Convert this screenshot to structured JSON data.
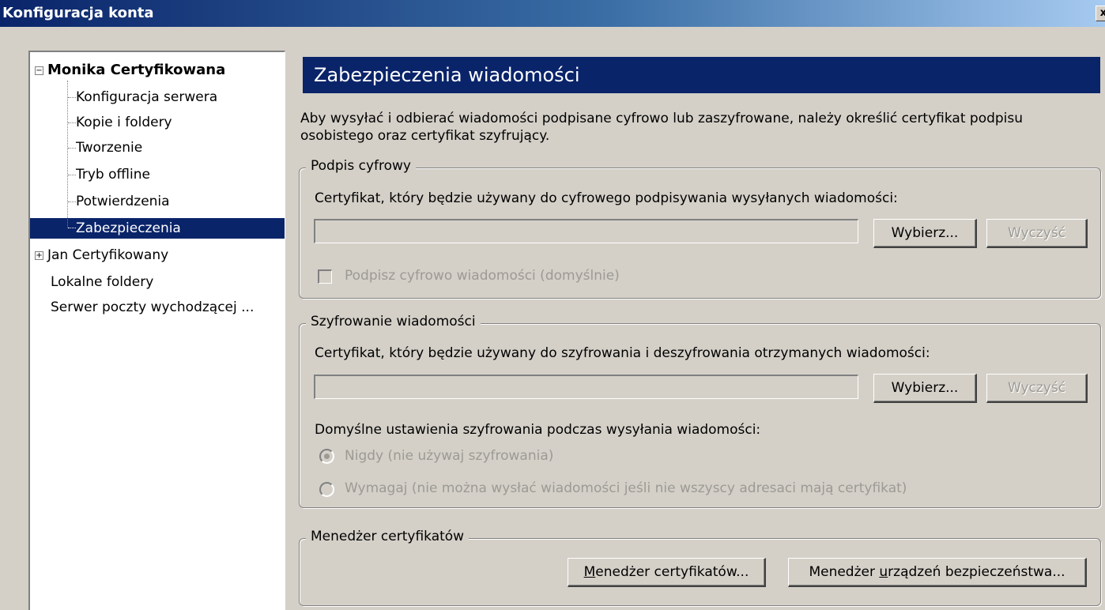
{
  "window": {
    "title": "Konfiguracja konta",
    "close_glyph": "x"
  },
  "tree": {
    "account1": {
      "label": "Monika Certyfikowana",
      "children": [
        "Konfiguracja serwera",
        "Kopie i foldery",
        "Tworzenie",
        "Tryb offline",
        "Potwierdzenia",
        "Zabezpieczenia"
      ],
      "selected_child": "Zabezpieczenia"
    },
    "account2": {
      "label": "Jan Certyfikowany"
    },
    "local_folders": "Lokalne foldery",
    "outgoing_server": "Serwer poczty wychodzącej ..."
  },
  "panel": {
    "title": "Zabezpieczenia wiadomości",
    "description": "Aby wysyłać i odbierać wiadomości podpisane cyfrowo lub zaszyfrowane, należy określić certyfikat podpisu osobistego oraz certyfikat szyfrujący.",
    "signing": {
      "legend": "Podpis cyfrowy",
      "cert_label": "Certyfikat, który będzie używany do cyfrowego podpisywania wysyłanych wiadomości:",
      "cert_value": "",
      "choose_button": "Wybierz...",
      "clear_button": "Wyczyść",
      "sign_checkbox": "Podpisz cyfrowo wiadomości (domyślnie)",
      "sign_checked": false
    },
    "encryption": {
      "legend": "Szyfrowanie wiadomości",
      "cert_label": "Certyfikat, który będzie używany do szyfrowania i deszyfrowania otrzymanych wiadomości:",
      "cert_value": "",
      "choose_button": "Wybierz...",
      "clear_button": "Wyczyść",
      "default_label": "Domyślne ustawienia szyfrowania podczas wysyłania wiadomości:",
      "option_never": "Nigdy (nie używaj szyfrowania)",
      "option_require": "Wymagaj (nie można wysłać wiadomości jeśli nie wszyscy adresaci mają certyfikat)",
      "selected_option": "never"
    },
    "cert_manager": {
      "legend": "Menedżer certyfikatów",
      "manager_button_prefix": "M",
      "manager_button_rest": "enedżer certyfikatów...",
      "devices_button_prefix": "Menedżer ",
      "devices_button_accel": "u",
      "devices_button_rest": "rządzeń bezpieczeństwa..."
    }
  },
  "colors": {
    "titlebar_start": "#0a246a",
    "titlebar_end": "#a6caf0",
    "selection": "#0a246a",
    "dialog_bg": "#d4d0c8",
    "disabled_text": "#9c9a94"
  }
}
